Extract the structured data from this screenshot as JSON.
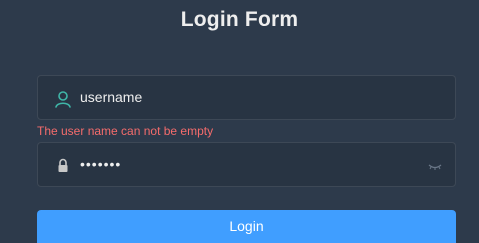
{
  "form": {
    "title": "Login Form",
    "username": {
      "value": "username",
      "icon": "user-icon",
      "error": "The user name can not be empty"
    },
    "password": {
      "masked_value": "•••••••",
      "icon": "lock-icon",
      "toggle_icon": "eye-closed-icon"
    },
    "login_label": "Login"
  },
  "colors": {
    "background": "#2d3a4b",
    "input_background": "#283443",
    "error": "#f56c6c",
    "button": "#409eff"
  }
}
